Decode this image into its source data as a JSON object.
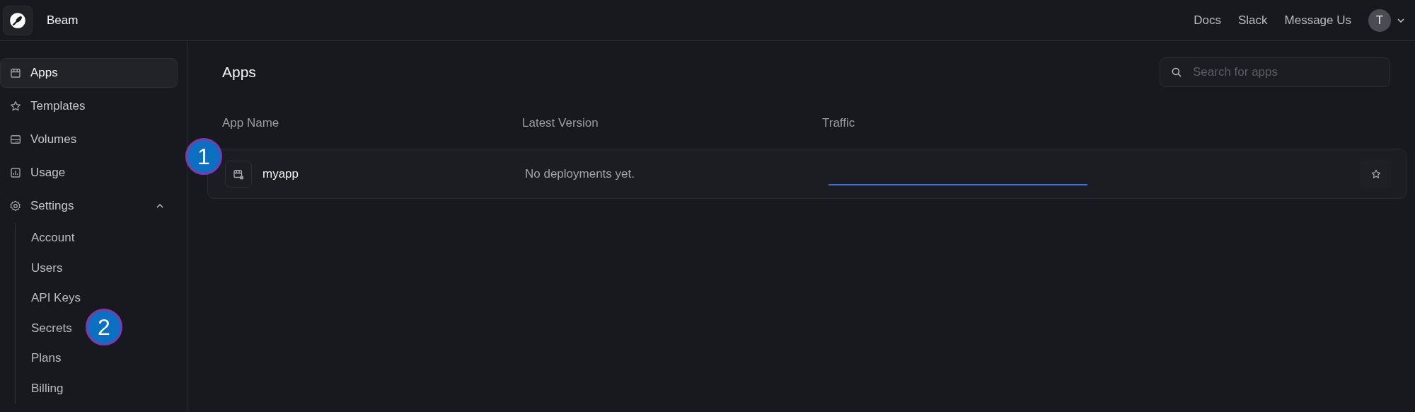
{
  "header": {
    "brand": "Beam",
    "links": [
      {
        "label": "Docs"
      },
      {
        "label": "Slack"
      },
      {
        "label": "Message Us"
      }
    ],
    "avatar": "T"
  },
  "sidebar": {
    "items": [
      {
        "label": "Apps",
        "selected": true
      },
      {
        "label": "Templates",
        "selected": false
      },
      {
        "label": "Volumes",
        "selected": false
      },
      {
        "label": "Usage",
        "selected": false
      },
      {
        "label": "Settings",
        "selected": false,
        "expanded": true,
        "children": [
          {
            "label": "Account"
          },
          {
            "label": "Users"
          },
          {
            "label": "API Keys"
          },
          {
            "label": "Secrets"
          },
          {
            "label": "Plans"
          },
          {
            "label": "Billing"
          }
        ]
      }
    ]
  },
  "main": {
    "title": "Apps",
    "search": {
      "placeholder": "Search for apps"
    },
    "table": {
      "columns": [
        "App Name",
        "Latest Version",
        "Traffic"
      ],
      "rows": [
        {
          "name": "myapp",
          "latest_version": "No deployments yet.",
          "starred": false
        }
      ]
    }
  },
  "annotations": [
    {
      "label": "1"
    },
    {
      "label": "2"
    }
  ]
}
